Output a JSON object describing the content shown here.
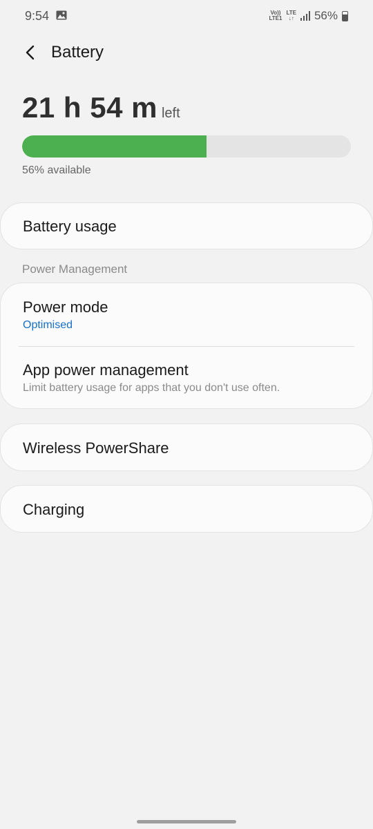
{
  "status_bar": {
    "time": "9:54",
    "volte_top": "Vo))",
    "volte_bottom": "LTE1",
    "lte_label": "LTE",
    "battery_percent": "56%",
    "icons": [
      "gallery-icon",
      "signal-icon",
      "battery-icon"
    ]
  },
  "header": {
    "title": "Battery",
    "back_icon": "chevron-left-icon"
  },
  "battery": {
    "time_left": "21 h 54 m",
    "time_left_suffix": "left",
    "level_fraction": 0.56,
    "available_text": "56% available",
    "bar_fill_color": "#4caf50",
    "bar_track_color": "#e4e4e4"
  },
  "battery_usage": {
    "label": "Battery usage"
  },
  "power_management": {
    "section_label": "Power Management",
    "power_mode": {
      "label": "Power mode",
      "value": "Optimised"
    },
    "app_power": {
      "label": "App power management",
      "description": "Limit battery usage for apps that you don't use often."
    }
  },
  "wireless_powershare": {
    "label": "Wireless PowerShare"
  },
  "charging": {
    "label": "Charging"
  },
  "colors": {
    "accent": "#1570c9",
    "background": "#f2f2f2",
    "card": "#fbfbfb"
  }
}
